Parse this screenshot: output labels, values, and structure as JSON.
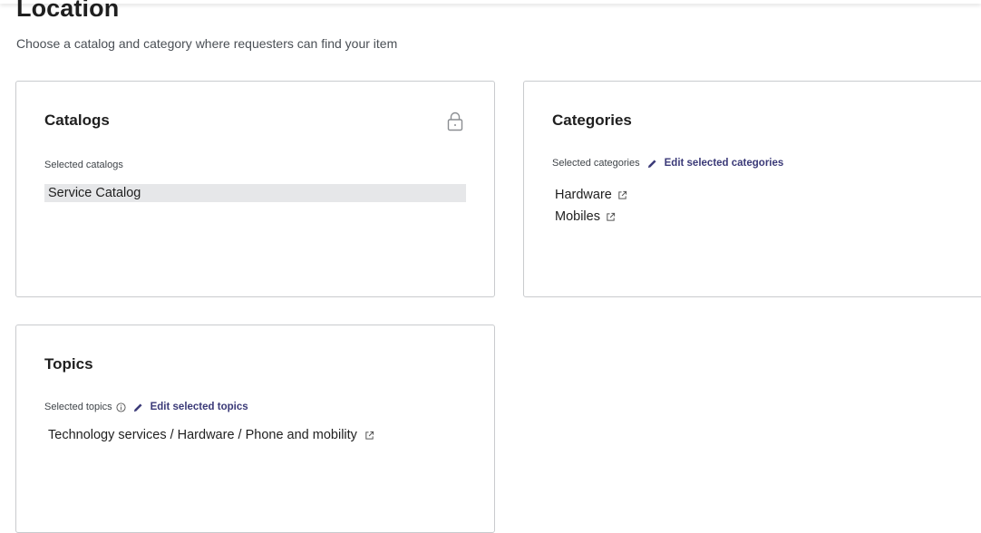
{
  "page": {
    "title": "Location",
    "subtitle": "Choose a catalog and category where requesters can find your item"
  },
  "catalogs": {
    "title": "Catalogs",
    "lock_icon": "lock-icon",
    "label": "Selected catalogs",
    "items": [
      "Service Catalog"
    ]
  },
  "categories": {
    "title": "Categories",
    "label": "Selected categories",
    "edit_label": "Edit selected categories",
    "items": [
      {
        "label": "Hardware",
        "icon": "external-link-icon"
      },
      {
        "label": "Mobiles",
        "icon": "external-link-icon"
      }
    ]
  },
  "topics": {
    "title": "Topics",
    "label": "Selected topics",
    "info_icon": "info-icon",
    "edit_label": "Edit selected topics",
    "items": [
      {
        "label": "Technology services / Hardware / Phone and mobility",
        "icon": "external-link-icon"
      }
    ]
  },
  "colors": {
    "link": "#3b3a78",
    "border": "#c9cbce",
    "chip_bg": "#e6e7e9",
    "text": "#1f1f1f"
  }
}
